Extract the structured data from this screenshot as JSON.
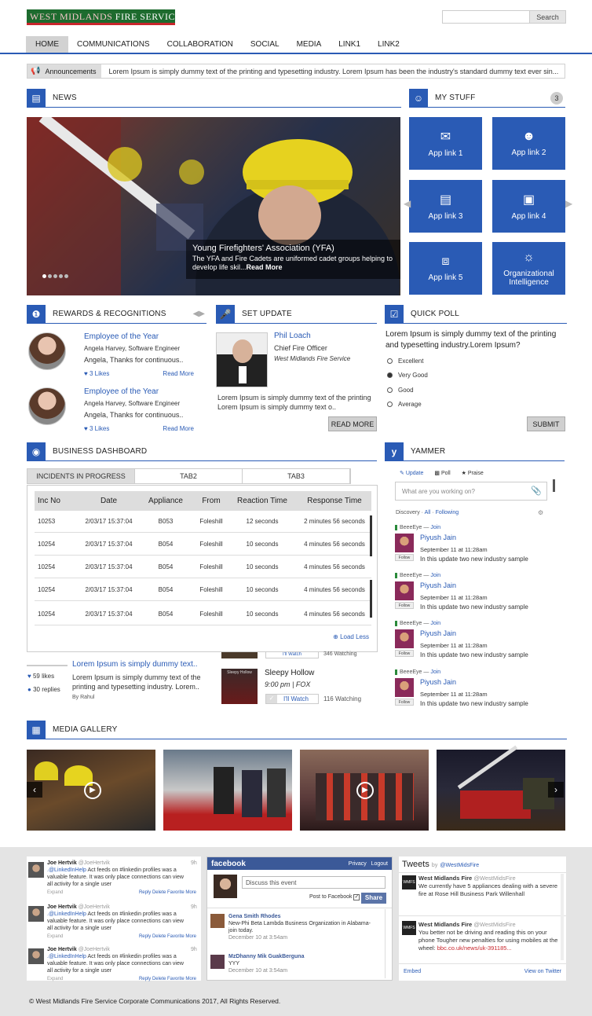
{
  "header": {
    "logo": "WEST MIDLANDS",
    "logo_accent": "FIRE SERVICE",
    "search_placeholder": "",
    "search_button": "Search"
  },
  "nav": [
    "HOME",
    "COMMUNICATIONS",
    "COLLABORATION",
    "SOCIAL",
    "MEDIA",
    "LINK1",
    "LINK2"
  ],
  "announcements": {
    "label": "Announcements",
    "text": "Lorem Ipsum is simply dummy text of the printing and typesetting industry. Lorem Ipsum has been the industry's standard dummy text ever sin..."
  },
  "news": {
    "title": "NEWS",
    "caption_title": "Young Firefighters' Association (YFA)",
    "caption_body": "The YFA and Fire Cadets are uniformed cadet groups helping to develop life skil...",
    "read_more": "Read More"
  },
  "mystuff": {
    "title": "MY STUFF",
    "count": "3",
    "tiles": [
      "App link 1",
      "App link 2",
      "App link 3",
      "App link 4",
      "App link 5",
      "Organizational Intelligence"
    ]
  },
  "rewards": {
    "title": "REWARDS & RECOGNITIONS",
    "items": [
      {
        "award": "Employee of the Year",
        "name": "Angela Harvey, Software Engineer",
        "desc": "Angela, Thanks for continuous..",
        "likes": "3 Likes",
        "more": "Read More"
      },
      {
        "award": "Employee of the Year",
        "name": "Angela Harvey, Software Engineer",
        "desc": "Angela, Thanks for continuous..",
        "likes": "3 Likes",
        "more": "Read More"
      }
    ]
  },
  "setupdate": {
    "title": "SET UPDATE",
    "name": "Phil Loach",
    "role": "Chief Fire Officer",
    "org": "West Midlands Fire Service",
    "text": "Lorem Ipsum is simply dummy text of the printing Lorem Ipsum is simply dummy text o..",
    "button": "READ MORE"
  },
  "poll": {
    "title": "QUICK POLL",
    "question": "Lorem Ipsum is simply dummy text of the printing and typesetting industry.Lorem Ipsum?",
    "options": [
      "Excellent",
      "Very Good",
      "Good",
      "Average"
    ],
    "selected": "Very Good",
    "submit": "SUBMIT"
  },
  "dashboard": {
    "title": "BUSINESS DASHBOARD",
    "tabs": [
      "INCIDENTS IN PROGRESS",
      "TAB2",
      "TAB3"
    ],
    "columns": [
      "Inc No",
      "Date",
      "Appliance",
      "From",
      "Reaction Time",
      "Response Time"
    ],
    "rows": [
      [
        "10253",
        "2/03/17 15:37:04",
        "B053",
        "Foleshill",
        "12 seconds",
        "2 minutes 56 seconds"
      ],
      [
        "10254",
        "2/03/17 15:37:04",
        "B054",
        "Foleshill",
        "10 seconds",
        "4 minutes 56 seconds"
      ],
      [
        "10254",
        "2/03/17 15:37:04",
        "B054",
        "Foleshill",
        "10 seconds",
        "4 minutes 56 seconds"
      ],
      [
        "10254",
        "2/03/17 15:37:04",
        "B054",
        "Foleshill",
        "10 seconds",
        "4 minutes 56 seconds"
      ],
      [
        "10254",
        "2/03/17 15:37:04",
        "B054",
        "Foleshill",
        "10 seconds",
        "4 minutes 56 seconds"
      ]
    ],
    "load_less": "Load Less"
  },
  "blog": {
    "title": "Lorem Ipsum is simply dummy text..",
    "body": "Lorem Ipsum is simply dummy text of the printing and typesetting industry. Lorem..",
    "by": "By Rahul",
    "likes": "59 likes",
    "replies": "30 replies"
  },
  "tv": {
    "show": "Sleepy Hollow",
    "time": "9:00 pm | FOX",
    "watch": "I'll Watch",
    "watching": "116 Watching",
    "prev_watch": "I'll Watch",
    "prev_watching": "346 Watching",
    "poster": "Sleepy Hollow"
  },
  "yammer": {
    "title": "YAMMER",
    "actions": [
      "Update",
      "Poll",
      "Praise"
    ],
    "placeholder": "What are you working on?",
    "discovery": "Discovery",
    "all": "All",
    "following": "Following",
    "network": "BeeeEye",
    "join": "Join",
    "follow": "Follow",
    "posts": [
      {
        "name": "Piyush Jain",
        "time": "September 11 at 11:28am",
        "text": "In this update two new industry sample"
      },
      {
        "name": "Piyush Jain",
        "time": "September 11 at 11:28am",
        "text": "In this update two new industry sample"
      },
      {
        "name": "Piyush Jain",
        "time": "September 11 at 11:28am",
        "text": "In this update two new industry sample"
      },
      {
        "name": "Piyush Jain",
        "time": "September 11 at 11:28am",
        "text": "In this update two new industry sample"
      }
    ]
  },
  "gallery": {
    "title": "MEDIA GALLERY"
  },
  "linkedin": {
    "items": [
      {
        "name": "Joe Hertvik",
        "handle": "@JoeHertvik",
        "age": "9h",
        "lead": ".@LinkedInHelp",
        "text": " Act feeds on #linkedin profiles was a valuable feature. It was only place connections can view all activity for a single user",
        "expand": "Expand",
        "actions": "Reply  Delete  Favorite  More"
      },
      {
        "name": "Joe Hertvik",
        "handle": "@JoeHertvik",
        "age": "9h",
        "lead": ".@LinkedInHelp",
        "text": " Act feeds on #linkedin profiles was a valuable feature. It was only place connections can view all activity for a single user",
        "expand": "Expand",
        "actions": "Reply  Delete  Favorite  More"
      },
      {
        "name": "Joe Hertvik",
        "handle": "@JoeHertvik",
        "age": "9h",
        "lead": ".@LinkedInHelp",
        "text": " Act feeds on #linkedin profiles was a valuable feature. It was only place connections can view all activity for a single user",
        "expand": "Expand",
        "actions": "Reply  Delete  Favorite  More"
      }
    ]
  },
  "facebook": {
    "brand": "facebook",
    "privacy": "Privacy",
    "logout": "Logout",
    "placeholder": "Discuss this event",
    "post_to": "Post to Facebook",
    "share": "Share",
    "items": [
      {
        "name": "Gena Smith Rhodes",
        "text": "New-Phi Beta Lambda Business Organization in Alabama-join today.",
        "date": "December 10 at 3:54am"
      },
      {
        "name": "MzDhanny Mik GuakBerguna",
        "text": "YYY",
        "date": "December 10 at 3:54am"
      }
    ]
  },
  "tweets": {
    "title": "Tweets",
    "by": "by",
    "handle": "@WestMidsFire",
    "items": [
      {
        "name": "West Midlands Fire",
        "handle": "@WestMidsFire",
        "text": "We currently have 5 appliances dealing with a severe fire at Rose Hill Business Park Willenhall"
      },
      {
        "name": "West Midlands Fire",
        "handle": "@WestMidsFire",
        "text": "You better not be driving and reading this on your phone  Tougher new penalties for using mobiles at the wheel: ",
        "link": "bbc.co.uk/news/uk-391185..."
      }
    ],
    "embed": "Embed",
    "view": "View on Twitter"
  },
  "footer": {
    "copyright": "© West Midlands Fire Service Corporate Communications 2017, All Rights Reserved."
  }
}
